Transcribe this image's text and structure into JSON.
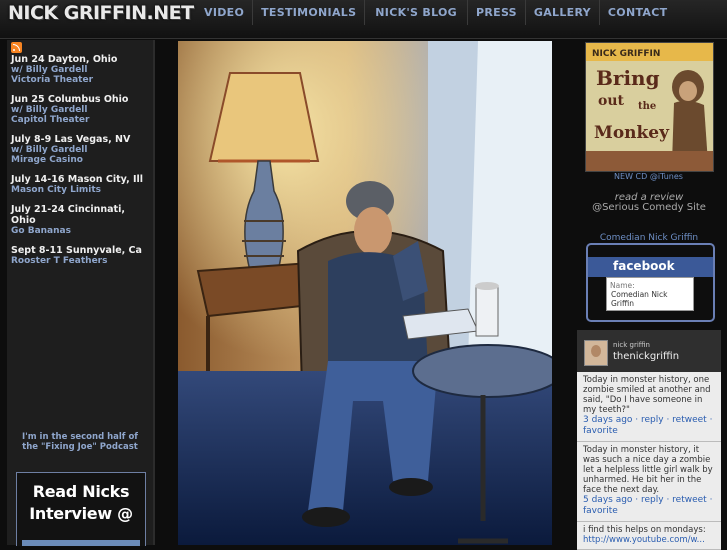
{
  "header": {
    "site_title": "NICK GRIFFIN.NET"
  },
  "nav": [
    "VIDEO",
    "TESTIMONIALS",
    "NICK'S BLOG",
    "PRESS",
    "GALLERY",
    "CONTACT"
  ],
  "events": [
    {
      "date": "Jun 24 Dayton, Ohio",
      "lines": [
        "w/ Billy Gardell",
        "Victoria Theater"
      ]
    },
    {
      "date": "Jun 25 Columbus Ohio",
      "lines": [
        "w/ Billy Gardell",
        "Capitol Theater"
      ]
    },
    {
      "date": "July 8-9 Las Vegas, NV",
      "lines": [
        "w/ Billy Gardell",
        "Mirage Casino"
      ]
    },
    {
      "date": "July 14-16 Mason City, Ill",
      "lines": [
        "Mason City Limits"
      ]
    },
    {
      "date": "July 21-24 Cincinnati, Ohio",
      "lines": [
        "Go Bananas"
      ]
    },
    {
      "date": "Sept 8-11 Sunnyvale, Ca",
      "lines": [
        "Rooster T Feathers"
      ]
    }
  ],
  "podcast_text": "I'm in the second half of the \"Fixing Joe\" Podcast",
  "interview": {
    "line1": "Read Nicks",
    "line2": "Interview @"
  },
  "album": {
    "artist": "NICK GRIFFIN",
    "title_words": [
      "Bring",
      "out",
      "the",
      "Monkey"
    ],
    "link": "NEW CD @iTunes"
  },
  "review": {
    "line1": "read a review",
    "line2": "@Serious Comedy Site"
  },
  "facebook": {
    "caption": "Comedian Nick Griffin",
    "logo": "facebook",
    "name_label": "Name:",
    "name": "Comedian Nick Griffin"
  },
  "twitter": {
    "small_name": "nick griffin",
    "handle": "thenickgriffin",
    "tweets": [
      {
        "text": "Today in monster history, one zombie smiled at another and said, \"Do I have someone in my teeth?\"",
        "meta": "3 days ago · reply · retweet · favorite"
      },
      {
        "text": "Today in monster history, it was such a nice day a zombie let a helpless little girl walk by unharmed. He bit her in the face the next day.",
        "meta": "5 days ago · reply · retweet · favorite"
      },
      {
        "text": "i find this helps on mondays:",
        "meta": "http://www.youtube.com/w..."
      }
    ]
  }
}
